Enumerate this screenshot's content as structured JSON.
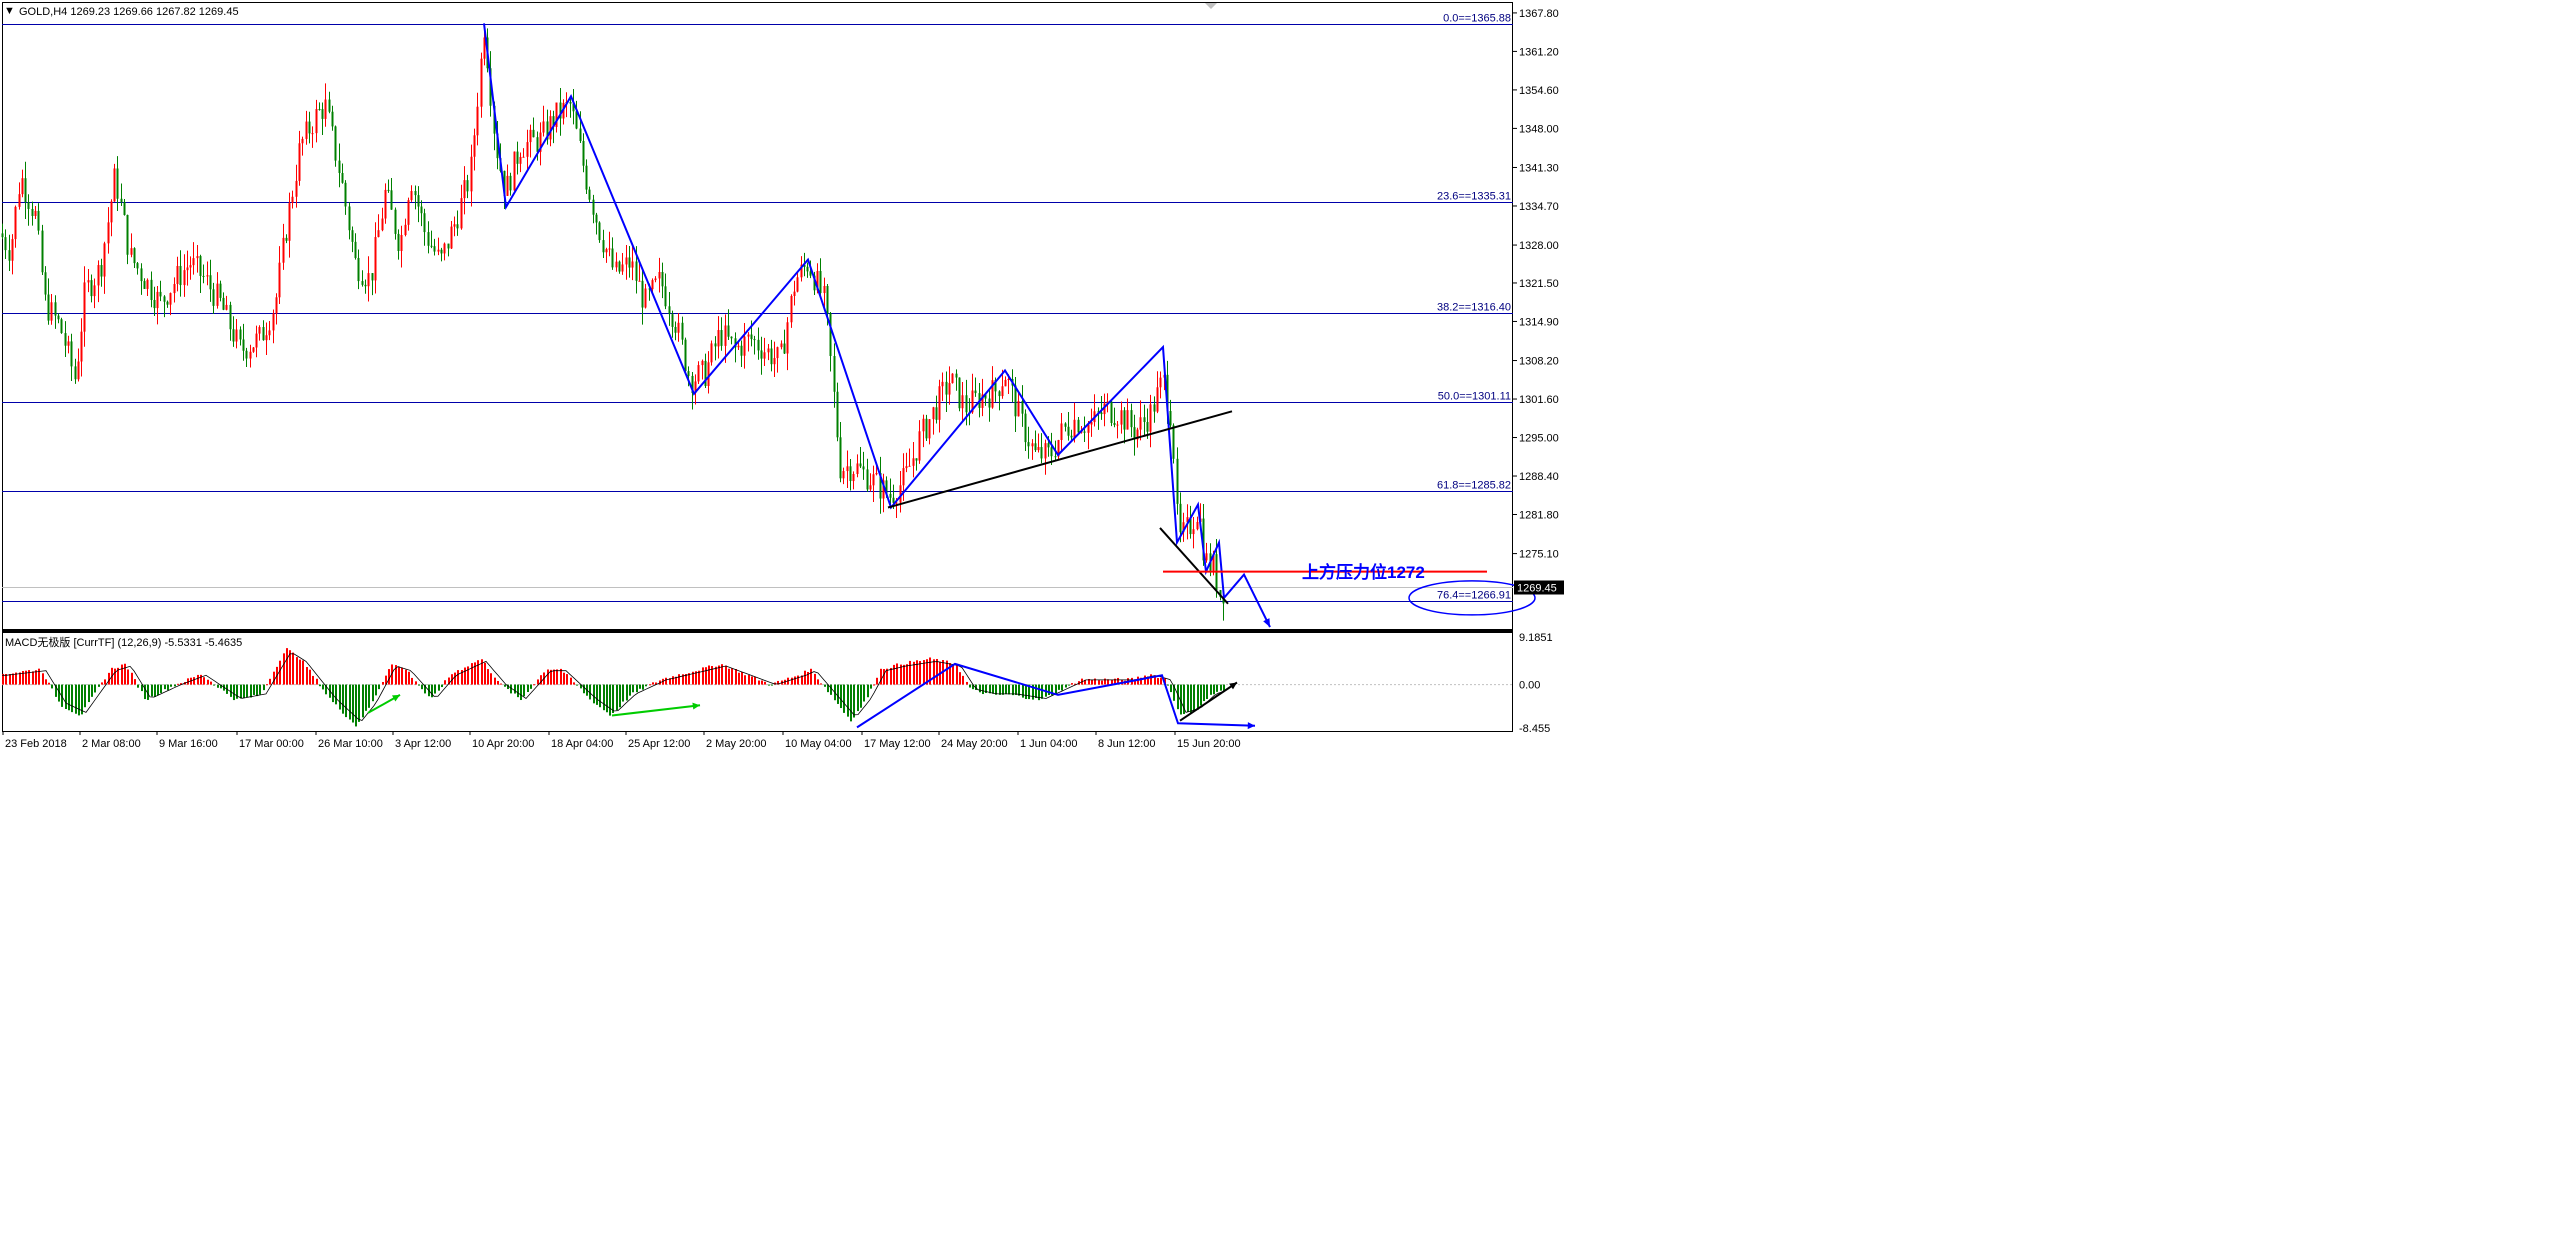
{
  "header": {
    "symbol_line": "GOLD,H4  1269.23 1269.66 1267.82 1269.45",
    "menu_glyph": "▼"
  },
  "macd": {
    "label": "MACD无极版 [CurrTF] (12,26,9) -5.5331 -5.4635",
    "axis_labels": [
      "9.1851",
      "0.00",
      "-8.455"
    ]
  },
  "annotation": {
    "text": "上方压力位1272",
    "level": 1272,
    "color": "#0000ff"
  },
  "current_price": "1269.45",
  "colors": {
    "bull": "#ff0000",
    "bear": "#008000",
    "fib": "#0000aa",
    "zigzag": "#0000ff",
    "trendline": "#000000",
    "resistance": "#ff0000"
  },
  "chart_data": [
    {
      "type": "candlestick",
      "title": "GOLD,H4",
      "ohlc_header": {
        "open": 1269.23,
        "high": 1269.66,
        "low": 1267.82,
        "close": 1269.45
      },
      "y_tick_labels": [
        "1367.80",
        "1361.20",
        "1354.60",
        "1348.00",
        "1341.30",
        "1334.70",
        "1328.00",
        "1321.50",
        "1314.90",
        "1308.20",
        "1301.60",
        "1295.00",
        "1288.40",
        "1281.80",
        "1275.10"
      ],
      "ylim": [
        1262.0,
        1369.5
      ],
      "x_tick_labels": [
        "23 Feb 2018",
        "2 Mar 08:00",
        "9 Mar 16:00",
        "17 Mar 00:00",
        "26 Mar 10:00",
        "3 Apr 12:00",
        "10 Apr 20:00",
        "18 Apr 04:00",
        "25 Apr 12:00",
        "2 May 20:00",
        "10 May 04:00",
        "17 May 12:00",
        "24 May 20:00",
        "1 Jun 04:00",
        "8 Jun 12:00",
        "15 Jun 20:00"
      ],
      "fibonacci_levels": [
        {
          "label": "0.0==1365.88",
          "value": 1365.88
        },
        {
          "label": "23.6==1335.31",
          "value": 1335.31
        },
        {
          "label": "38.2==1316.40",
          "value": 1316.4
        },
        {
          "label": "50.0==1301.11",
          "value": 1301.11
        },
        {
          "label": "61.8==1285.82",
          "value": 1285.82
        },
        {
          "label": "76.4==1266.91",
          "value": 1266.91
        }
      ],
      "price_path": [
        [
          0,
          1330
        ],
        [
          10,
          1327
        ],
        [
          20,
          1340
        ],
        [
          35,
          1333
        ],
        [
          45,
          1318
        ],
        [
          60,
          1314
        ],
        [
          75,
          1305
        ],
        [
          85,
          1320
        ],
        [
          100,
          1324
        ],
        [
          115,
          1340
        ],
        [
          130,
          1326
        ],
        [
          145,
          1322
        ],
        [
          160,
          1318
        ],
        [
          175,
          1322
        ],
        [
          190,
          1325
        ],
        [
          205,
          1322
        ],
        [
          220,
          1318
        ],
        [
          240,
          1310
        ],
        [
          260,
          1312
        ],
        [
          275,
          1318
        ],
        [
          285,
          1330
        ],
        [
          300,
          1345
        ],
        [
          315,
          1350
        ],
        [
          325,
          1352
        ],
        [
          340,
          1340
        ],
        [
          355,
          1325
        ],
        [
          370,
          1322
        ],
        [
          385,
          1337
        ],
        [
          400,
          1328
        ],
        [
          410,
          1340
        ],
        [
          425,
          1330
        ],
        [
          440,
          1325
        ],
        [
          455,
          1332
        ],
        [
          470,
          1340
        ],
        [
          484,
          1366
        ],
        [
          495,
          1346
        ],
        [
          505,
          1337
        ],
        [
          520,
          1345
        ],
        [
          540,
          1346
        ],
        [
          555,
          1350
        ],
        [
          570,
          1352
        ],
        [
          585,
          1340
        ],
        [
          600,
          1330
        ],
        [
          615,
          1323
        ],
        [
          630,
          1325
        ],
        [
          645,
          1318
        ],
        [
          660,
          1322
        ],
        [
          675,
          1315
        ],
        [
          690,
          1305
        ],
        [
          705,
          1306
        ],
        [
          720,
          1313
        ],
        [
          735,
          1310
        ],
        [
          750,
          1312
        ],
        [
          765,
          1310
        ],
        [
          780,
          1308
        ],
        [
          795,
          1322
        ],
        [
          808,
          1325
        ],
        [
          825,
          1318
        ],
        [
          840,
          1290
        ],
        [
          855,
          1290
        ],
        [
          870,
          1288
        ],
        [
          890,
          1285
        ],
        [
          905,
          1288
        ],
        [
          920,
          1295
        ],
        [
          935,
          1300
        ],
        [
          950,
          1305
        ],
        [
          965,
          1300
        ],
        [
          980,
          1302
        ],
        [
          995,
          1303
        ],
        [
          1005,
          1306
        ],
        [
          1020,
          1298
        ],
        [
          1035,
          1292
        ],
        [
          1050,
          1292
        ],
        [
          1062,
          1296
        ],
        [
          1075,
          1298
        ],
        [
          1090,
          1297
        ],
        [
          1105,
          1300
        ],
        [
          1120,
          1299
        ],
        [
          1135,
          1296
        ],
        [
          1150,
          1299
        ],
        [
          1163,
          1305
        ],
        [
          1172,
          1298
        ],
        [
          1178,
          1277
        ],
        [
          1190,
          1280
        ],
        [
          1198,
          1283
        ],
        [
          1205,
          1274
        ],
        [
          1213,
          1273
        ],
        [
          1220,
          1268
        ],
        [
          1225,
          1269.45
        ]
      ],
      "zigzag_path": [
        [
          484,
          1366
        ],
        [
          506,
          1334.5
        ],
        [
          571,
          1353.5
        ],
        [
          694,
          1302.5
        ],
        [
          808,
          1325.5
        ],
        [
          891,
          1283
        ],
        [
          1005,
          1306.5
        ],
        [
          1058,
          1292
        ],
        [
          1163,
          1310.5
        ],
        [
          1177,
          1277
        ],
        [
          1198,
          1283.5
        ],
        [
          1206,
          1272
        ],
        [
          1219,
          1277
        ],
        [
          1224,
          1267.5
        ],
        [
          1244,
          1271.5
        ],
        [
          1270,
          1262.5
        ]
      ],
      "trendlines": [
        {
          "color": "#000000",
          "points": [
            [
              888,
              1283
            ],
            [
              1232,
              1299.5
            ]
          ]
        },
        {
          "color": "#000000",
          "points": [
            [
              1160,
              1279.5
            ],
            [
              1228,
              1266.5
            ]
          ]
        }
      ],
      "resistance_line": {
        "value": 1272,
        "x_range": [
          1163,
          1487
        ]
      },
      "annotation_ellipse": {
        "center": [
          1472,
          1267.5
        ],
        "text_ref": "76.4==1266.91"
      }
    },
    {
      "type": "bar",
      "title": "MACD无极版 [CurrTF] (12,26,9)",
      "values": {
        "macd": -5.5331,
        "signal": -5.4635
      },
      "ylim": [
        -9.0,
        10.0
      ],
      "y_tick_labels": [
        "9.1851",
        "0.00",
        "-8.455"
      ],
      "histogram_keypoints": [
        [
          0,
          2
        ],
        [
          40,
          3
        ],
        [
          60,
          -4
        ],
        [
          80,
          -6
        ],
        [
          110,
          3
        ],
        [
          125,
          4
        ],
        [
          145,
          -3
        ],
        [
          175,
          0
        ],
        [
          200,
          2
        ],
        [
          235,
          -3
        ],
        [
          260,
          -2
        ],
        [
          285,
          7
        ],
        [
          300,
          5
        ],
        [
          330,
          -3
        ],
        [
          355,
          -8
        ],
        [
          370,
          -4
        ],
        [
          390,
          4
        ],
        [
          405,
          3
        ],
        [
          430,
          -3
        ],
        [
          450,
          2
        ],
        [
          480,
          5
        ],
        [
          500,
          0
        ],
        [
          520,
          -3
        ],
        [
          545,
          3
        ],
        [
          560,
          3
        ],
        [
          590,
          -3
        ],
        [
          610,
          -6
        ],
        [
          630,
          -2
        ],
        [
          660,
          1
        ],
        [
          680,
          2
        ],
        [
          700,
          3
        ],
        [
          720,
          4
        ],
        [
          745,
          2
        ],
        [
          770,
          0
        ],
        [
          800,
          2
        ],
        [
          810,
          3
        ],
        [
          830,
          -2
        ],
        [
          850,
          -7
        ],
        [
          865,
          -3
        ],
        [
          880,
          3
        ],
        [
          900,
          4
        ],
        [
          930,
          5
        ],
        [
          955,
          4
        ],
        [
          970,
          -1
        ],
        [
          990,
          -2
        ],
        [
          1010,
          -2
        ],
        [
          1040,
          -3
        ],
        [
          1060,
          -1
        ],
        [
          1080,
          1
        ],
        [
          1100,
          1
        ],
        [
          1130,
          1
        ],
        [
          1150,
          2
        ],
        [
          1165,
          1
        ],
        [
          1180,
          -6
        ],
        [
          1195,
          -5
        ],
        [
          1210,
          -2
        ],
        [
          1225,
          -1
        ]
      ],
      "arrows": [
        {
          "color": "#0000ff",
          "points": [
            [
              857,
              -8.3
            ],
            [
              955,
              4.0
            ],
            [
              1058,
              -2.0
            ],
            [
              1162,
              1.8
            ],
            [
              1178,
              -7.5
            ],
            [
              1255,
              -8.0
            ]
          ]
        },
        {
          "color": "#000000",
          "points": [
            [
              1180,
              -7.0
            ],
            [
              1237,
              0.4
            ]
          ]
        },
        {
          "color": "#00cc00",
          "points": [
            [
              368,
              -5.5
            ],
            [
              400,
              -2.0
            ]
          ]
        },
        {
          "color": "#00cc00",
          "points": [
            [
              612,
              -6.0
            ],
            [
              700,
              -4.0
            ]
          ]
        }
      ]
    }
  ]
}
